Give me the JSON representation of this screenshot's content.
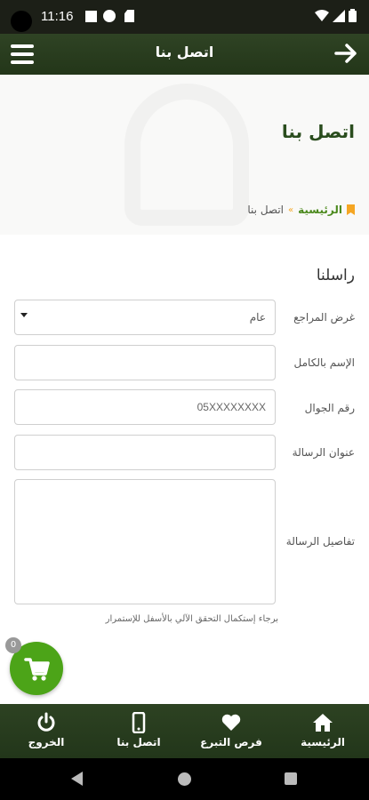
{
  "status_bar": {
    "time": "11:16"
  },
  "header": {
    "title": "اتصل بنا"
  },
  "banner": {
    "heading": "اتصل بنا"
  },
  "breadcrumb": {
    "home": "الرئيسية",
    "separator": "»",
    "current": "اتصل بنا"
  },
  "form": {
    "section_title": "راسلنا",
    "program_label": "غرض المراجع",
    "program_value": "عام",
    "fullname_label": "الإسم بالكامل",
    "fullname_value": "",
    "mobile_label": "رقم الجوال",
    "mobile_placeholder": "05XXXXXXXX",
    "subject_label": "عنوان الرسالة",
    "subject_value": "",
    "details_label": "تفاصيل الرسالة",
    "details_value": "",
    "captcha_note": "برجاء إستكمال التحقق الآلي بالأسفل للإستمرار"
  },
  "cart": {
    "count": "0",
    "icon": "cart-icon"
  },
  "bottom_nav": [
    {
      "label": "الرئيسية",
      "icon": "home-icon"
    },
    {
      "label": "فرص التبرع",
      "icon": "heart-icon"
    },
    {
      "label": "اتصل بنا",
      "icon": "phone-icon"
    },
    {
      "label": "الخروج",
      "icon": "power-icon"
    }
  ],
  "colors": {
    "header_bg": "#2f4324",
    "accent_green": "#4ca418",
    "heading_green": "#2a4d1e",
    "bookmark_orange": "#f5a623"
  }
}
